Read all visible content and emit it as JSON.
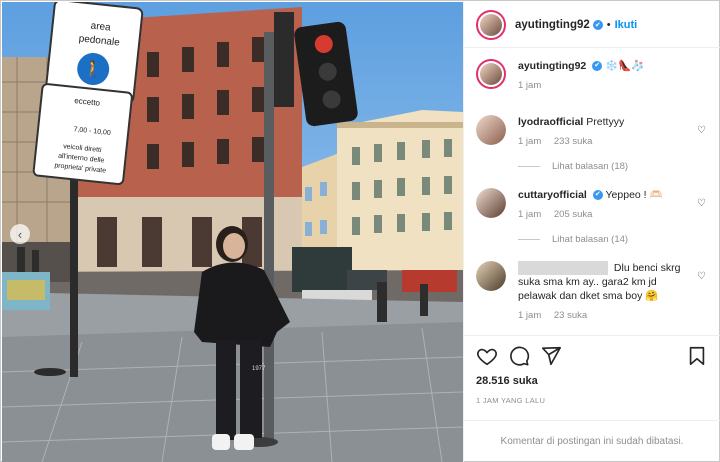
{
  "post": {
    "username": "ayutingting92",
    "follow_label": "Ikuti",
    "separator": "•",
    "caption_emoji": "❄️👠🧦",
    "caption_time": "1 jam"
  },
  "photo": {
    "sign_title": "area\npedonale",
    "sign_eccetto": "eccetto",
    "sign_hours": "7,00 - 10,00",
    "sign_text": "veicoli diretti\nall'interno delle\nproprieta' private",
    "shirt_number": "1977"
  },
  "comments": [
    {
      "username": "lyodraofficial",
      "verified": false,
      "text": "Prettyyy",
      "time": "1 jam",
      "likes": "233 suka",
      "replies": "Lihat balasan (18)"
    },
    {
      "username": "cuttaryofficial",
      "verified": true,
      "text": "Yeppeo ! 🫶🏻",
      "time": "1 jam",
      "likes": "205 suka",
      "replies": "Lihat balasan (14)"
    },
    {
      "username": "",
      "verified": false,
      "text": "Dlu benci skrg suka sma km ay.. gara2 km jd pelawak dan dket sma boy 🤗",
      "time": "1 jam",
      "likes": "23 suka",
      "replies": ""
    }
  ],
  "likes": "28.516 suka",
  "timestamp": "1 JAM YANG LALU",
  "comments_closed": "Komentar di postingan ini sudah dibatasi.",
  "icons": [
    "heart-icon",
    "comment-icon",
    "share-icon",
    "bookmark-icon",
    "verified-icon",
    "carousel-prev-icon"
  ],
  "colors": {
    "link": "#0095f6",
    "verified": "#3897f0",
    "muted": "#8e8e8e"
  }
}
